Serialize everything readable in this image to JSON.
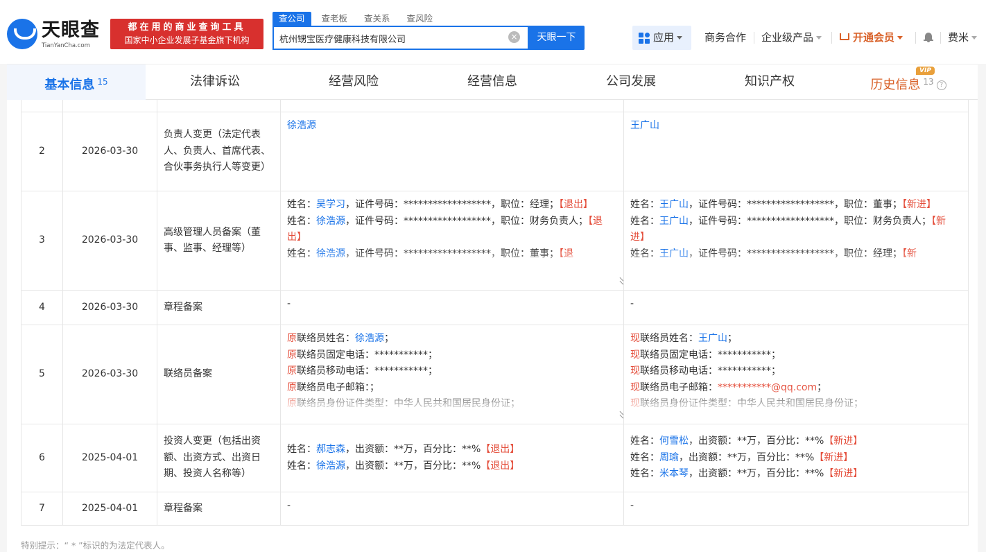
{
  "header": {
    "logo_name": "天眼查",
    "logo_domain": "TianYanCha.com",
    "slogan_line1": "都在用的商业查询工具",
    "slogan_line2": "国家中小企业发展子基金旗下机构",
    "search_tabs": [
      "查公司",
      "查老板",
      "查关系",
      "查风险"
    ],
    "search_value": "杭州甥宝医疗健康科技有限公司",
    "search_button": "天眼一下",
    "nav": {
      "apps": "应用",
      "business": "商务合作",
      "enterprise": "企业级产品",
      "vip": "开通会员",
      "user": "费米"
    }
  },
  "tabs": [
    {
      "label": "基本信息",
      "count": "15"
    },
    {
      "label": "法律诉讼"
    },
    {
      "label": "经营风险"
    },
    {
      "label": "经营信息"
    },
    {
      "label": "公司发展"
    },
    {
      "label": "知识产权"
    },
    {
      "label": "历史信息",
      "count": "13",
      "badge": "VIP"
    }
  ],
  "rows": [
    {
      "no": "2",
      "date": "2026-03-30",
      "item": "负责人变更（法定代表人、负责人、首席代表、合伙事务执行人等变更）",
      "before": "徐浩源",
      "after": "王广山"
    },
    {
      "no": "3",
      "date": "2026-03-30",
      "item": "高级管理人员备案（董事、监事、经理等）",
      "before": [
        {
          "p1": "姓名：",
          "name": "吴学习",
          "p2": "，证件号码：******************，职位：经理；",
          "tag": "【退出】"
        },
        {
          "p1": "姓名：",
          "name": "徐浩源",
          "p2": "，证件号码：******************，职位：财务负责人；",
          "tag": "【退出】"
        },
        {
          "p1": "姓名：",
          "name": "徐浩源",
          "p2": "，证件号码：******************，职位：董事；",
          "tag": "【退"
        }
      ],
      "after": [
        {
          "p1": "姓名：",
          "name": "王广山",
          "p2": "，证件号码：******************，职位：董事；",
          "tag": "【新进】"
        },
        {
          "p1": "姓名：",
          "name": "王广山",
          "p2": "，证件号码：******************，职位：财务负责人；",
          "tag": "【新进】"
        },
        {
          "p1": "姓名：",
          "name": "王广山",
          "p2": "，证件号码：******************，职位：经理；",
          "tag": "【新"
        }
      ]
    },
    {
      "no": "4",
      "date": "2026-03-30",
      "item": "章程备案",
      "before": "-",
      "after": "-"
    },
    {
      "no": "5",
      "date": "2026-03-30",
      "item": "联络员备案",
      "before": {
        "prefix": "原",
        "lines": [
          {
            "label": "联络员姓名：",
            "value": "徐浩源",
            "suffix": "；"
          },
          {
            "label": "联络员固定电话：***********；"
          },
          {
            "label": "联络员移动电话：***********；"
          },
          {
            "label": "联络员电子邮箱：；"
          },
          {
            "label": "联络员身份证件类型：中华人民共和国居民身份证；"
          }
        ]
      },
      "after": {
        "prefix": "现",
        "lines": [
          {
            "label": "联络员姓名：",
            "value": "王广山",
            "suffix": "；"
          },
          {
            "label": "联络员固定电话：***********；"
          },
          {
            "label": "联络员移动电话：***********；"
          },
          {
            "label": "联络员电子邮箱：",
            "value": "***********@qq.com",
            "suffix": "；"
          },
          {
            "label": "联络员身份证件类型：中华人民共和国居民身份证；"
          }
        ]
      }
    },
    {
      "no": "6",
      "date": "2025-04-01",
      "item": "投资人变更（包括出资额、出资方式、出资日期、投资人名称等）",
      "before": [
        {
          "p1": "姓名：",
          "name": "郝志森",
          "p2": "，出资额：**万，百分比：**%",
          "tag": "【退出】"
        },
        {
          "p1": "姓名：",
          "name": "徐浩源",
          "p2": "，出资额：**万，百分比：**%",
          "tag": "【退出】"
        }
      ],
      "after": [
        {
          "p1": "姓名：",
          "name": "何雪松",
          "p2": "，出资额：**万，百分比：**%",
          "tag": "【新进】"
        },
        {
          "p1": "姓名：",
          "name": "周瑜",
          "p2": "，出资额：**万，百分比：**%",
          "tag": "【新进】"
        },
        {
          "p1": "姓名：",
          "name": "米本琴",
          "p2": "，出资额：**万，百分比：**%",
          "tag": "【新进】"
        }
      ]
    },
    {
      "no": "7",
      "date": "2025-04-01",
      "item": "章程备案",
      "before": "-",
      "after": "-"
    }
  ],
  "footnote": "特别提示：“ * ”标识的为法定代表人。",
  "colors": {
    "brand": "#1a73e8",
    "slogan": "#d8302e",
    "vip": "#d9622a",
    "tag_red": "#e44d3a"
  }
}
